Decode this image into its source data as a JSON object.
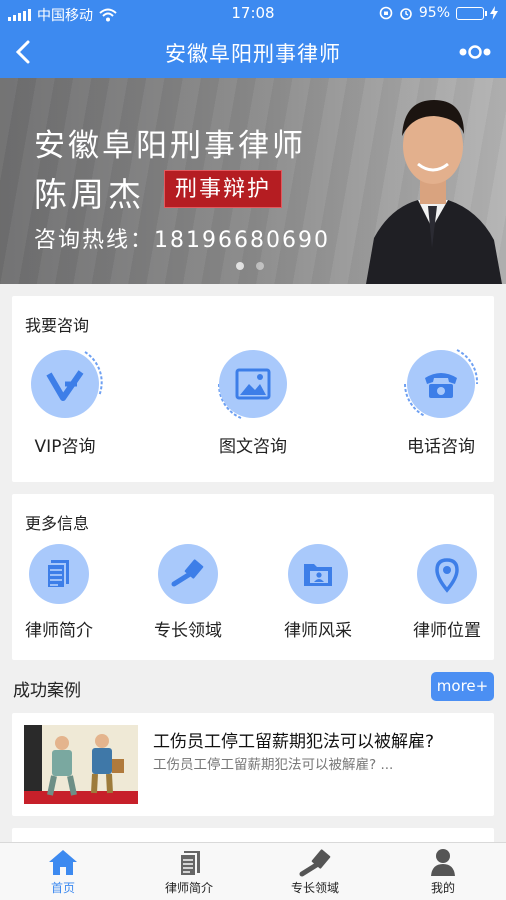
{
  "status_bar": {
    "carrier": "中国移动",
    "time": "17:08",
    "battery": "95%",
    "battery_level": 0.95
  },
  "nav": {
    "title": "安徽阜阳刑事律师"
  },
  "banner": {
    "line1": "安徽阜阳刑事律师",
    "name": "陈周杰",
    "tag": "刑事辩护",
    "hotline": "咨询热线：18196680690"
  },
  "consult": {
    "title": "我要咨询",
    "items": [
      {
        "label": "VIP咨询",
        "icon": "vip-icon"
      },
      {
        "label": "图文咨询",
        "icon": "image-icon"
      },
      {
        "label": "电话咨询",
        "icon": "phone-icon"
      }
    ]
  },
  "more_info": {
    "title": "更多信息",
    "items": [
      {
        "label": "律师简介",
        "icon": "document-icon"
      },
      {
        "label": "专长领域",
        "icon": "gavel-icon"
      },
      {
        "label": "律师风采",
        "icon": "folder-portrait-icon"
      },
      {
        "label": "律师位置",
        "icon": "location-pin-icon"
      }
    ]
  },
  "cases": {
    "title": "成功案例",
    "more_label": "more+",
    "items": [
      {
        "title": "工伤员工停工留薪期犯法可以被解雇?",
        "desc": "工伤员工停工留薪期犯法可以被解雇? ..."
      }
    ]
  },
  "tabbar": {
    "items": [
      {
        "label": "首页",
        "icon": "home-icon",
        "active": true
      },
      {
        "label": "律师简介",
        "icon": "document-icon",
        "active": false
      },
      {
        "label": "专长领域",
        "icon": "gavel-icon",
        "active": false
      },
      {
        "label": "我的",
        "icon": "user-icon",
        "active": false
      }
    ]
  },
  "colors": {
    "primary": "#3d8af0",
    "icon_circle": "#a9c9fb",
    "tag_red": "#b51d22",
    "battery": "#ffd21f"
  }
}
